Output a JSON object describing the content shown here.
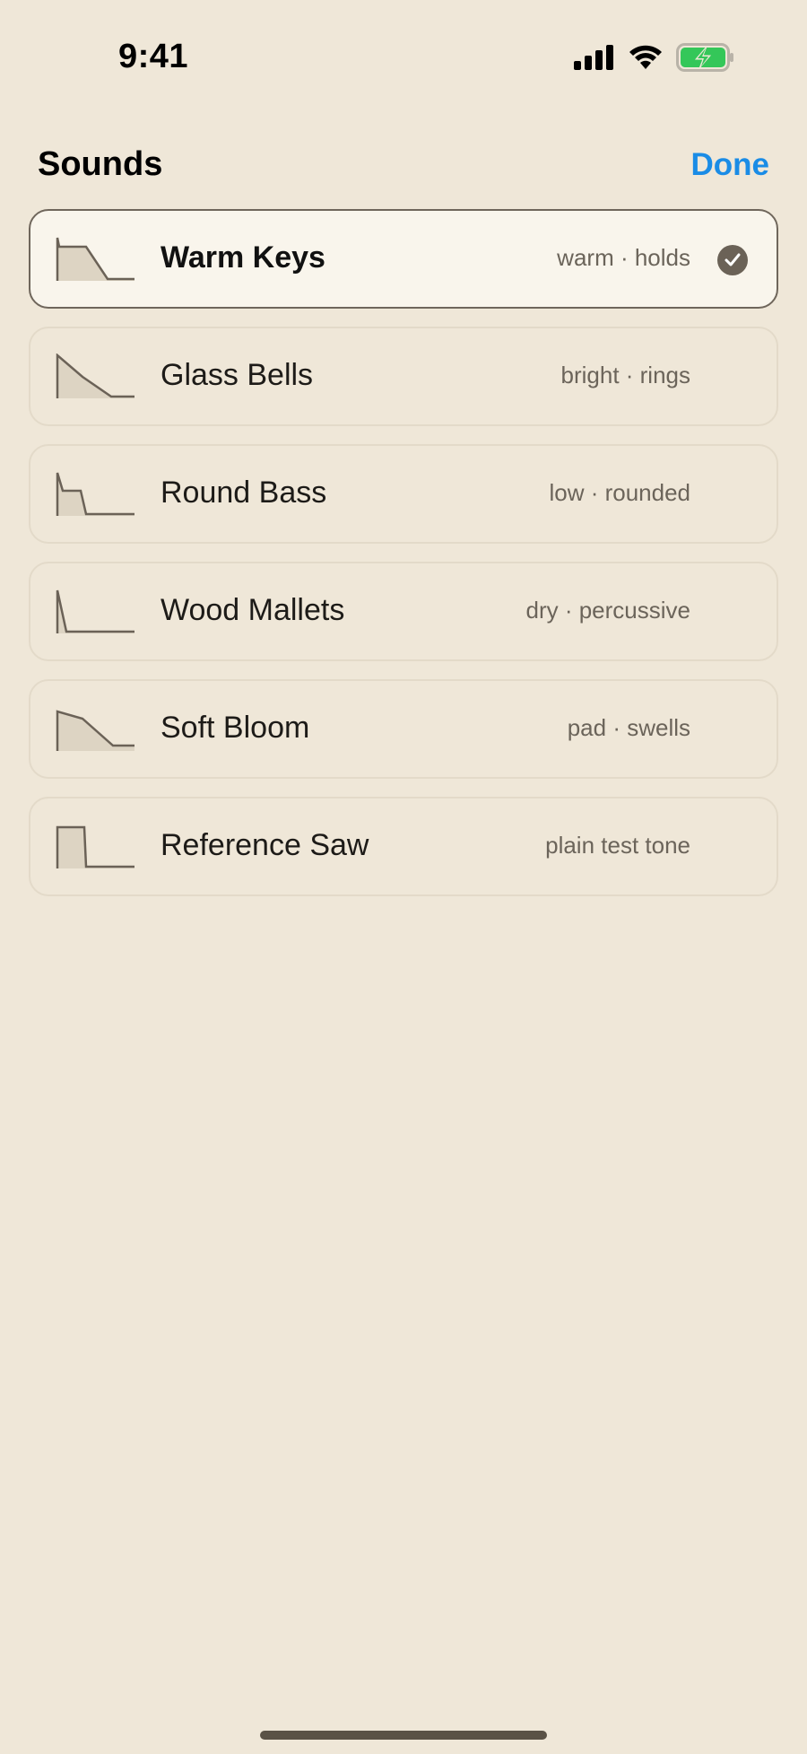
{
  "status_bar": {
    "time": "9:41",
    "icons": [
      "signal-icon",
      "wifi-icon",
      "battery-charging-icon"
    ],
    "battery_color": "#34c759"
  },
  "header": {
    "title": "Sounds",
    "done_label": "Done",
    "accent": "#1a8ce6"
  },
  "sounds": [
    {
      "name": "Warm Keys",
      "description": "warm · holds",
      "selected": true,
      "envelope_icon": "envelope-hold-icon"
    },
    {
      "name": "Glass Bells",
      "description": "bright · rings",
      "selected": false,
      "envelope_icon": "envelope-ring-icon"
    },
    {
      "name": "Round Bass",
      "description": "low · rounded",
      "selected": false,
      "envelope_icon": "envelope-bass-icon"
    },
    {
      "name": "Wood Mallets",
      "description": "dry · percussive",
      "selected": false,
      "envelope_icon": "envelope-percussive-icon"
    },
    {
      "name": "Soft Bloom",
      "description": "pad · swells",
      "selected": false,
      "envelope_icon": "envelope-swell-icon"
    },
    {
      "name": "Reference Saw",
      "description": "plain test tone",
      "selected": false,
      "envelope_icon": "envelope-square-icon"
    }
  ]
}
